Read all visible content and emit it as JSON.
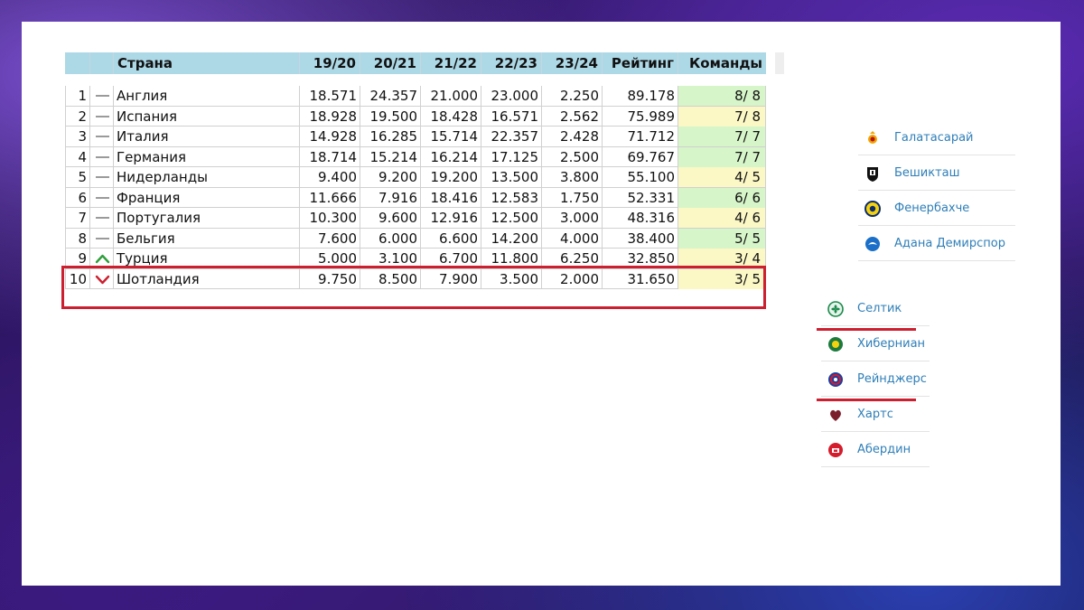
{
  "table": {
    "headers": {
      "country": "Страна",
      "seasons": [
        "19/20",
        "20/21",
        "21/22",
        "22/23",
        "23/24"
      ],
      "rating": "Рейтинг",
      "teams": "Команды"
    },
    "rows": [
      {
        "rank": "1",
        "trend": "none",
        "country": "Англия",
        "seasons": [
          "18.571",
          "24.357",
          "21.000",
          "23.000",
          "2.250"
        ],
        "rating": "89.178",
        "teams": "8/ 8",
        "teams_color": "green"
      },
      {
        "rank": "2",
        "trend": "none",
        "country": "Испания",
        "seasons": [
          "18.928",
          "19.500",
          "18.428",
          "16.571",
          "2.562"
        ],
        "rating": "75.989",
        "teams": "7/ 8",
        "teams_color": "yellow"
      },
      {
        "rank": "3",
        "trend": "none",
        "country": "Италия",
        "seasons": [
          "14.928",
          "16.285",
          "15.714",
          "22.357",
          "2.428"
        ],
        "rating": "71.712",
        "teams": "7/ 7",
        "teams_color": "green"
      },
      {
        "rank": "4",
        "trend": "none",
        "country": "Германия",
        "seasons": [
          "18.714",
          "15.214",
          "16.214",
          "17.125",
          "2.500"
        ],
        "rating": "69.767",
        "teams": "7/ 7",
        "teams_color": "green"
      },
      {
        "rank": "5",
        "trend": "none",
        "country": "Нидерланды",
        "seasons": [
          "9.400",
          "9.200",
          "19.200",
          "13.500",
          "3.800"
        ],
        "rating": "55.100",
        "teams": "4/ 5",
        "teams_color": "yellow"
      },
      {
        "rank": "6",
        "trend": "none",
        "country": "Франция",
        "seasons": [
          "11.666",
          "7.916",
          "18.416",
          "12.583",
          "1.750"
        ],
        "rating": "52.331",
        "teams": "6/ 6",
        "teams_color": "green"
      },
      {
        "rank": "7",
        "trend": "none",
        "country": "Португалия",
        "seasons": [
          "10.300",
          "9.600",
          "12.916",
          "12.500",
          "3.000"
        ],
        "rating": "48.316",
        "teams": "4/ 6",
        "teams_color": "yellow"
      },
      {
        "rank": "8",
        "trend": "none",
        "country": "Бельгия",
        "seasons": [
          "7.600",
          "6.000",
          "6.600",
          "14.200",
          "4.000"
        ],
        "rating": "38.400",
        "teams": "5/ 5",
        "teams_color": "green"
      },
      {
        "rank": "9",
        "trend": "up",
        "country": "Турция",
        "seasons": [
          "5.000",
          "3.100",
          "6.700",
          "11.800",
          "6.250"
        ],
        "rating": "32.850",
        "teams": "3/ 4",
        "teams_color": "yellow"
      },
      {
        "rank": "10",
        "trend": "down",
        "country": "Шотландия",
        "seasons": [
          "9.750",
          "8.500",
          "7.900",
          "3.500",
          "2.000"
        ],
        "rating": "31.650",
        "teams": "3/ 5",
        "teams_color": "yellow"
      }
    ]
  },
  "turkish_clubs": [
    {
      "name": "Галатасарай",
      "icon": "galatasaray-logo-icon"
    },
    {
      "name": "Бешикташ",
      "icon": "besiktas-logo-icon"
    },
    {
      "name": "Фенербахче",
      "icon": "fenerbahce-logo-icon"
    },
    {
      "name": "Адана Демирспор",
      "icon": "adana-demirspor-logo-icon"
    }
  ],
  "scottish_clubs": [
    {
      "name": "Селтик",
      "icon": "celtic-logo-icon",
      "struck": false
    },
    {
      "name": "Хиберниан",
      "icon": "hibernian-logo-icon",
      "struck": true
    },
    {
      "name": "Рейнджерс",
      "icon": "rangers-logo-icon",
      "struck": false
    },
    {
      "name": "Хартс",
      "icon": "hearts-logo-icon",
      "struck": true
    },
    {
      "name": "Абердин",
      "icon": "aberdeen-logo-icon",
      "struck": false
    }
  ],
  "colors": {
    "header_bg": "#add8e6",
    "teams_green": "#d6f5c8",
    "teams_yellow": "#fbf8c6",
    "highlight": "#cc1f2f",
    "trend_up": "#2e9e3a",
    "trend_down": "#cc1f2f",
    "club_link": "#2f7fb8"
  }
}
